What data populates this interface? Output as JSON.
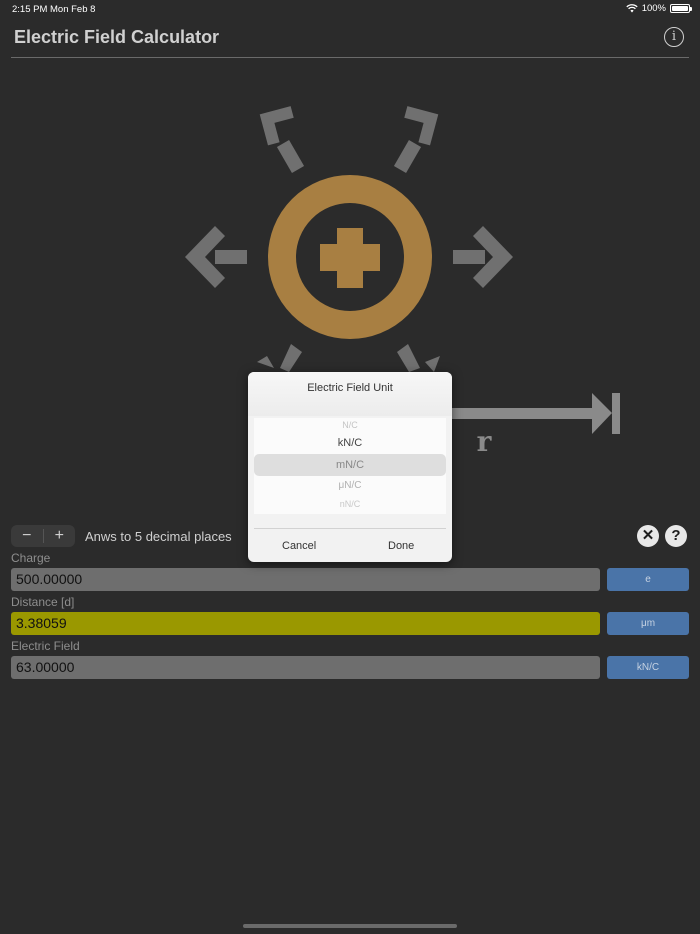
{
  "status_bar": {
    "time": "2:15 PM",
    "date": "Mon Feb 8",
    "battery": "100%",
    "battery_level": 1.0
  },
  "header": {
    "title": "Electric Field Calculator",
    "info_icon": "info-icon"
  },
  "diagram": {
    "charge_symbol": "plus-icon",
    "distance_label": "r"
  },
  "controls": {
    "decrease_label": "−",
    "increase_label": "+",
    "decimal_label": "Anws to 5 decimal places",
    "clear_label": "✕",
    "help_label": "?"
  },
  "fields": [
    {
      "label": "Charge",
      "value": "500.00000",
      "unit": "e",
      "active": false
    },
    {
      "label": "Distance [d]",
      "value": "3.38059",
      "unit": "μm",
      "active": true
    },
    {
      "label": "Electric Field",
      "value": "63.00000",
      "unit": "kN/C",
      "active": false
    }
  ],
  "dialog": {
    "title": "Electric Field Unit",
    "options": [
      "N/C",
      "kN/C",
      "mN/C",
      "μN/C",
      "nN/C"
    ],
    "selected": "mN/C",
    "cancel_label": "Cancel",
    "done_label": "Done"
  },
  "colors": {
    "background": "#2b2b2b",
    "charge_ring": "#a87f42",
    "active_field": "#9a9800",
    "unit_button": "#4a74a8",
    "field": "#6e6e6e",
    "arrow": "#707070"
  }
}
